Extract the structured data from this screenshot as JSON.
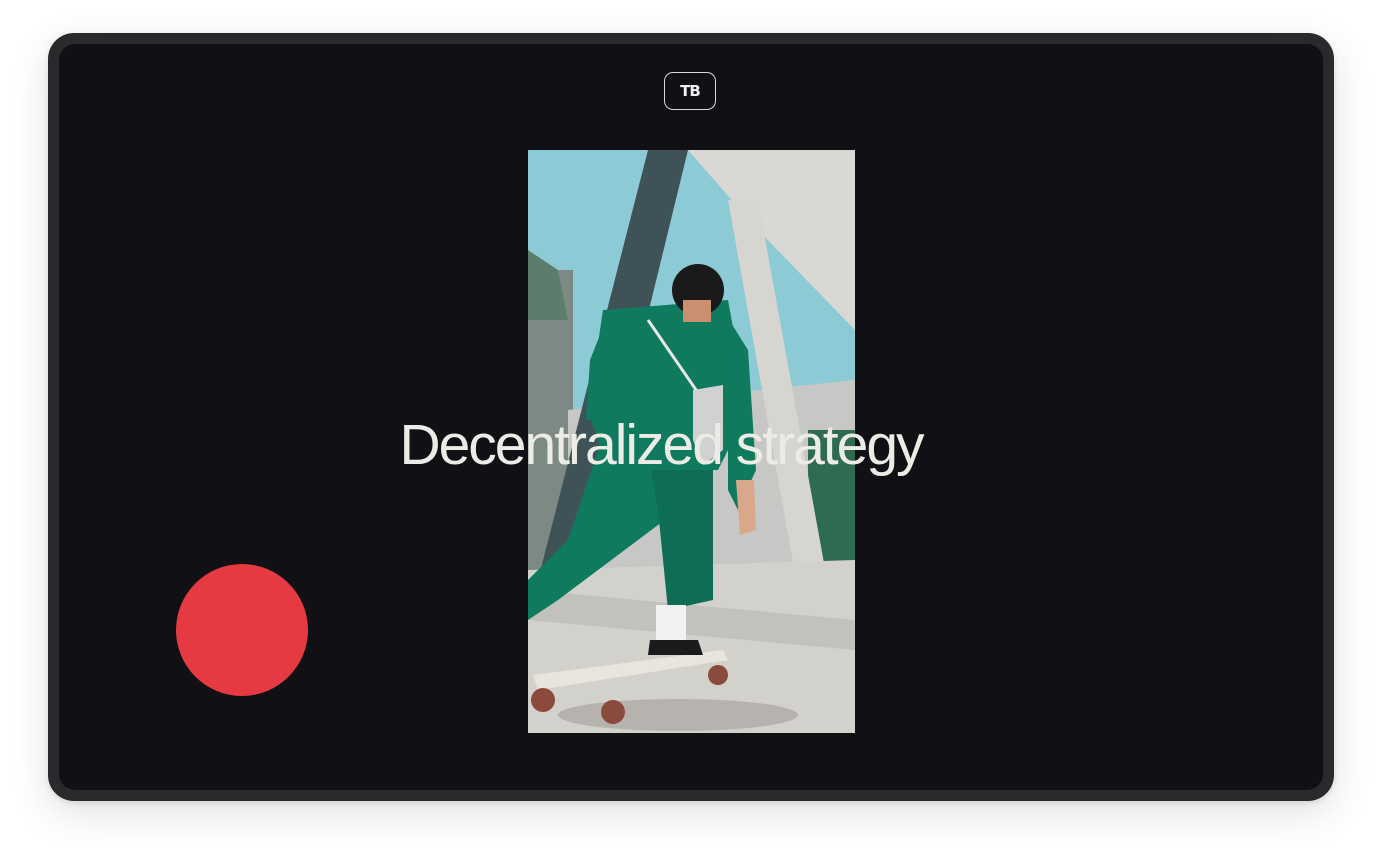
{
  "brand": {
    "logo_text": "TB"
  },
  "hero": {
    "headline": "Decentralized strategy"
  },
  "colors": {
    "screen_bg": "#111115",
    "frame": "#2a2a2c",
    "headline": "#ecebe6",
    "accent_dot": "#e63a43",
    "jumpsuit": "#0f7a5e",
    "sky": "#8ccbd6"
  }
}
